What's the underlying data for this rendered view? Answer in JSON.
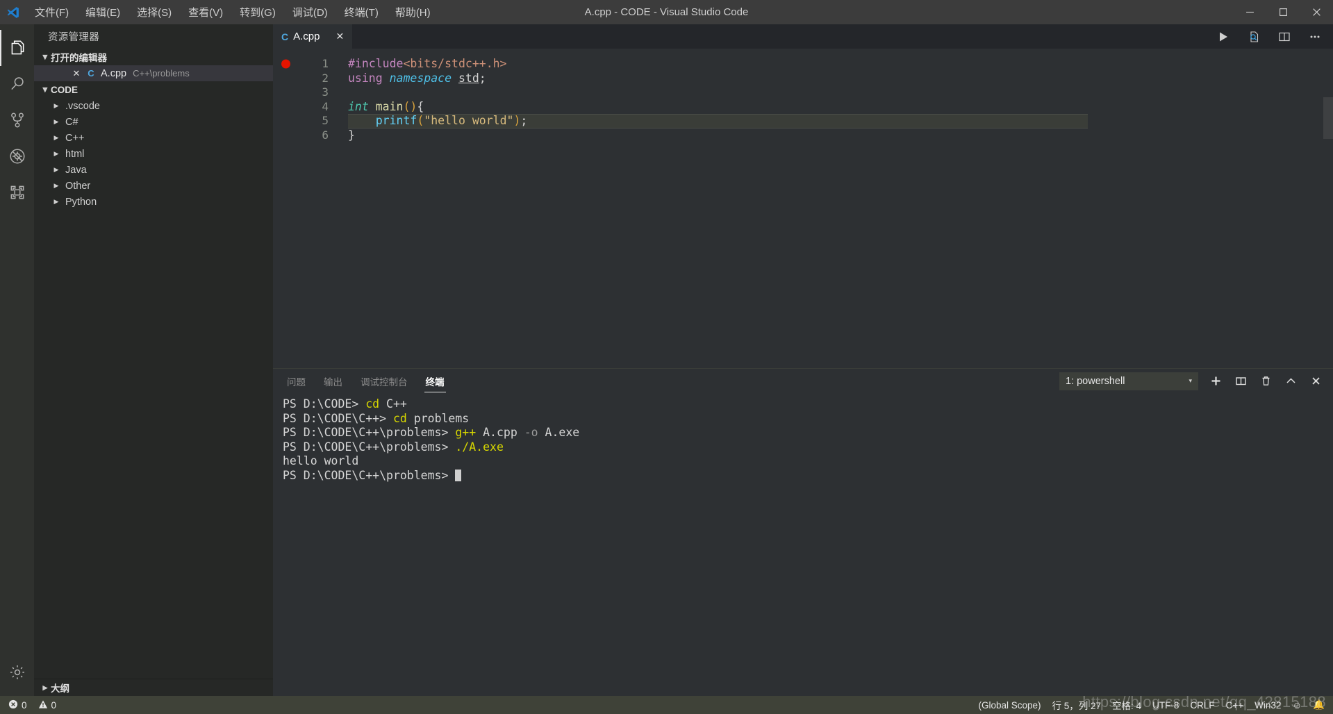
{
  "window": {
    "title": "A.cpp - CODE - Visual Studio Code",
    "menu": [
      "文件(F)",
      "编辑(E)",
      "选择(S)",
      "查看(V)",
      "转到(G)",
      "调试(D)",
      "终端(T)",
      "帮助(H)"
    ],
    "controls": {
      "minimize": "minimize-icon",
      "maximize": "maximize-icon",
      "close": "close-icon"
    }
  },
  "activitybar": {
    "items": [
      {
        "name": "explorer",
        "icon": "files-icon",
        "active": true
      },
      {
        "name": "search",
        "icon": "search-icon",
        "active": false
      },
      {
        "name": "source-control",
        "icon": "source-control-icon",
        "active": false
      },
      {
        "name": "debug",
        "icon": "no-debug-icon",
        "active": false
      },
      {
        "name": "extensions",
        "icon": "extensions-icon",
        "active": false
      }
    ],
    "settings": {
      "name": "manage",
      "icon": "gear-icon"
    }
  },
  "sidebar": {
    "title": "资源管理器",
    "open_editors": {
      "label": "打开的编辑器",
      "items": [
        {
          "name": "A.cpp",
          "description": "C++\\problems",
          "icon": "cpp-file-icon",
          "selected": true,
          "close": "✕"
        }
      ]
    },
    "workspace": {
      "label": "CODE",
      "folders": [
        {
          "label": ".vscode"
        },
        {
          "label": "C#"
        },
        {
          "label": "C++"
        },
        {
          "label": "html"
        },
        {
          "label": "Java"
        },
        {
          "label": "Other"
        },
        {
          "label": "Python"
        }
      ]
    },
    "outline": {
      "label": "大纲"
    }
  },
  "editor": {
    "tabs": [
      {
        "label": "A.cpp",
        "icon": "cpp-file-icon",
        "close": "✕",
        "active": true
      }
    ],
    "actions": [
      {
        "name": "run-code-button",
        "icon": "play-icon"
      },
      {
        "name": "preview-button",
        "icon": "file-search-icon"
      },
      {
        "name": "split-editor-button",
        "icon": "split-editor-icon"
      },
      {
        "name": "more-actions-button",
        "icon": "ellipsis-icon"
      }
    ],
    "breakpoint_line": 1,
    "current_line": 5,
    "lines": [
      {
        "no": "1",
        "tokens": [
          {
            "t": "#include",
            "c": "t-pre"
          },
          {
            "t": "<bits/stdc++.h>",
            "c": "t-inc"
          }
        ]
      },
      {
        "no": "2",
        "tokens": [
          {
            "t": "using ",
            "c": "t-kw"
          },
          {
            "t": "namespace ",
            "c": "t-ns"
          },
          {
            "t": "std",
            "c": "t-id-u"
          },
          {
            "t": ";",
            "c": "t-punc"
          }
        ]
      },
      {
        "no": "3",
        "tokens": [
          {
            "t": "",
            "c": "t-plain"
          }
        ]
      },
      {
        "no": "4",
        "tokens": [
          {
            "t": "int ",
            "c": "t-type"
          },
          {
            "t": "main",
            "c": "t-fn"
          },
          {
            "t": "()",
            "c": "t-paren"
          },
          {
            "t": "{",
            "c": "t-punc"
          }
        ]
      },
      {
        "no": "5",
        "tokens": [
          {
            "t": "    ",
            "c": "t-plain"
          },
          {
            "t": "printf",
            "c": "t-fn2"
          },
          {
            "t": "(",
            "c": "t-paren"
          },
          {
            "t": "\"hello world\"",
            "c": "t-str"
          },
          {
            "t": ")",
            "c": "t-paren"
          },
          {
            "t": ";",
            "c": "t-punc"
          }
        ]
      },
      {
        "no": "6",
        "tokens": [
          {
            "t": "}",
            "c": "t-punc"
          }
        ]
      }
    ]
  },
  "panel": {
    "tabs": [
      {
        "label": "问题",
        "active": false
      },
      {
        "label": "输出",
        "active": false
      },
      {
        "label": "调试控制台",
        "active": false
      },
      {
        "label": "终端",
        "active": true
      }
    ],
    "terminal_select": {
      "value": "1: powershell",
      "caret": "▾"
    },
    "actions": [
      {
        "name": "new-terminal-button",
        "icon": "plus-icon"
      },
      {
        "name": "split-terminal-button",
        "icon": "split-icon"
      },
      {
        "name": "kill-terminal-button",
        "icon": "trash-icon"
      },
      {
        "name": "maximize-panel-button",
        "icon": "chevron-up-icon"
      },
      {
        "name": "close-panel-button",
        "icon": "close-icon"
      }
    ],
    "terminal_lines": [
      [
        {
          "t": "PS D:\\CODE> ",
          "c": "tk-prompt"
        },
        {
          "t": "cd",
          "c": "tk-cmd"
        },
        {
          "t": " C++",
          "c": "tk-arg"
        }
      ],
      [
        {
          "t": "PS D:\\CODE\\C++> ",
          "c": "tk-prompt"
        },
        {
          "t": "cd",
          "c": "tk-cmd"
        },
        {
          "t": " problems",
          "c": "tk-arg"
        }
      ],
      [
        {
          "t": "PS D:\\CODE\\C++\\problems> ",
          "c": "tk-prompt"
        },
        {
          "t": "g++",
          "c": "tk-cmd"
        },
        {
          "t": " A.cpp ",
          "c": "tk-arg"
        },
        {
          "t": "-o",
          "c": "tk-opt"
        },
        {
          "t": " A.exe",
          "c": "tk-arg"
        }
      ],
      [
        {
          "t": "PS D:\\CODE\\C++\\problems> ",
          "c": "tk-prompt"
        },
        {
          "t": "./A.exe",
          "c": "tk-cmd"
        }
      ],
      [
        {
          "t": "hello world",
          "c": "tk-out"
        }
      ],
      [
        {
          "t": "PS D:\\CODE\\C++\\problems> ",
          "c": "tk-prompt"
        }
      ]
    ]
  },
  "statusbar": {
    "left": [
      {
        "name": "errors",
        "icon": "error-icon",
        "label": "0"
      },
      {
        "name": "warnings",
        "icon": "warning-icon",
        "label": "0"
      }
    ],
    "right": [
      {
        "name": "scope",
        "label": "(Global Scope)"
      },
      {
        "name": "cursor-position",
        "label": "行 5，列 27"
      },
      {
        "name": "indentation",
        "label": "空格: 4"
      },
      {
        "name": "encoding",
        "label": "UTF-8"
      },
      {
        "name": "eol",
        "label": "CRLF"
      },
      {
        "name": "language-mode",
        "label": "C++"
      },
      {
        "name": "platform",
        "label": "Win32"
      },
      {
        "name": "feedback",
        "label": "☺"
      },
      {
        "name": "notifications",
        "label": "🔔"
      }
    ]
  },
  "watermark": {
    "text": "https://blog.csdn.net/qq_42815188"
  },
  "colors": {
    "titlebar_bg": "#3c3c3c",
    "activitybar_bg": "#2f312e",
    "sidebar_bg": "#262826",
    "editor_bg": "#2d3033",
    "statusbar_bg": "#3f4238",
    "accent": "#4fa8e0",
    "breakpoint_red": "#e51400",
    "terminal_cmd": "#d7d700"
  }
}
